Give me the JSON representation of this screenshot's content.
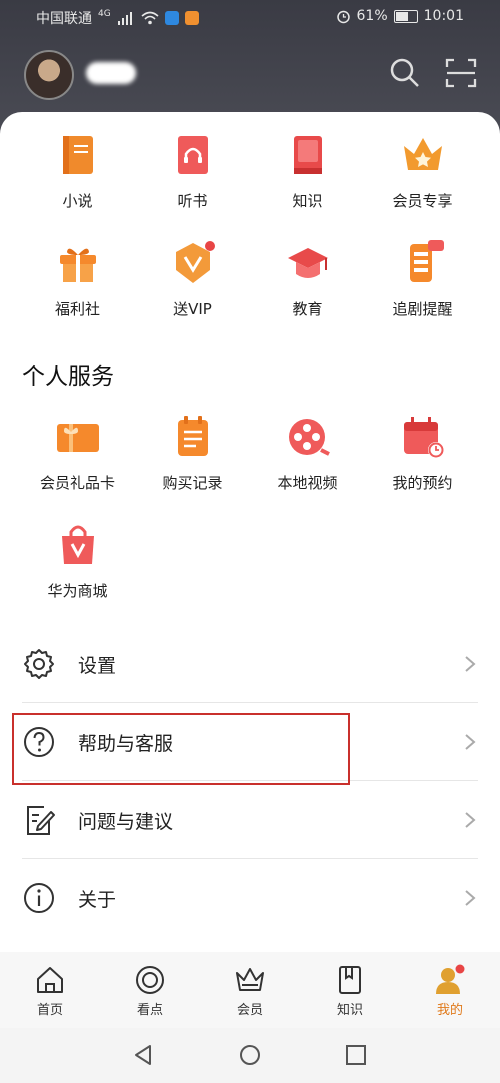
{
  "status": {
    "carrier": "中国联通",
    "network": "4G",
    "battery": "61%",
    "time": "10:01"
  },
  "quick_grid": [
    {
      "label": "小说",
      "icon": "book-icon",
      "color": "#f08a2c"
    },
    {
      "label": "听书",
      "icon": "headphone-book-icon",
      "color": "#ef5a5a"
    },
    {
      "label": "知识",
      "icon": "red-book-icon",
      "color": "#e84a4a"
    },
    {
      "label": "会员专享",
      "icon": "crown-icon",
      "color": "#f29a2e"
    },
    {
      "label": "福利社",
      "icon": "gift-icon",
      "color": "#f5892c"
    },
    {
      "label": "送VIP",
      "icon": "vip-badge-icon",
      "color": "#f39a3a"
    },
    {
      "label": "教育",
      "icon": "graduation-cap-icon",
      "color": "#e84a4a"
    },
    {
      "label": "追剧提醒",
      "icon": "phone-reminder-icon",
      "color": "#f5892c"
    }
  ],
  "personal_services": {
    "title": "个人服务",
    "items": [
      {
        "label": "会员礼品卡",
        "icon": "gift-card-icon"
      },
      {
        "label": "购买记录",
        "icon": "purchase-record-icon"
      },
      {
        "label": "本地视频",
        "icon": "film-reel-icon"
      },
      {
        "label": "我的预约",
        "icon": "calendar-icon"
      },
      {
        "label": "华为商城",
        "icon": "shopping-bag-icon"
      }
    ]
  },
  "menu": [
    {
      "label": "设置",
      "icon": "gear-icon"
    },
    {
      "label": "帮助与客服",
      "icon": "help-circle-icon"
    },
    {
      "label": "问题与建议",
      "icon": "feedback-edit-icon"
    },
    {
      "label": "关于",
      "icon": "info-circle-icon"
    }
  ],
  "tabs": [
    {
      "label": "首页",
      "icon": "home-icon"
    },
    {
      "label": "看点",
      "icon": "discover-icon"
    },
    {
      "label": "会员",
      "icon": "crown-outline-icon"
    },
    {
      "label": "知识",
      "icon": "book-outline-icon"
    },
    {
      "label": "我的",
      "icon": "profile-icon",
      "active": true
    }
  ],
  "accent_color": "#e07a1c",
  "highlight_color": "#c9302c"
}
